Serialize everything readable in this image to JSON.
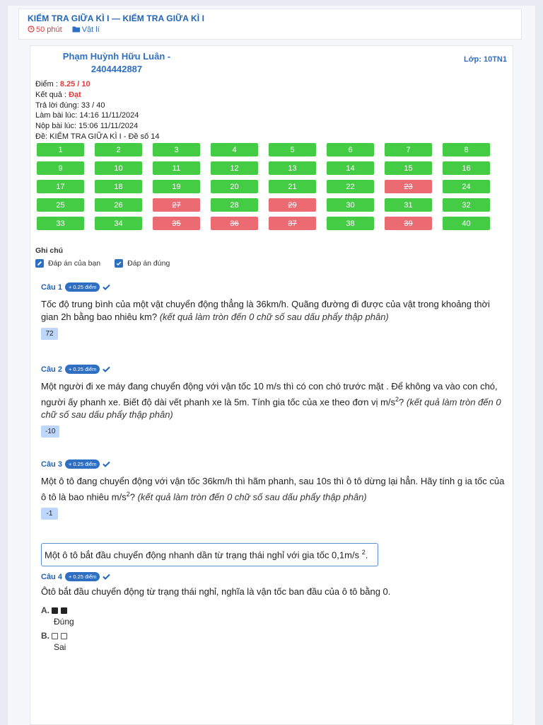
{
  "header": {
    "title": "KIỂM TRA GIỮA KÌ I — KIỂM TRA GIỮA KÌ I",
    "duration": "50 phút",
    "subject": "Vật lí"
  },
  "student": {
    "name": "Phạm Huỳnh Hữu Luân - 2404442887",
    "class_label": "Lớp: 10TN1"
  },
  "info": {
    "score_label": "Điểm :",
    "score_value": "8.25 / 10",
    "result_label": "Kết quả :",
    "result_value": "Đạt",
    "correct": "Trả lời đúng: 33 / 40",
    "start": "Làm bài lúc: 14:16 11/11/2024",
    "submit": "Nộp bài lúc: 15:06 11/11/2024",
    "exam": "Đề: KIỂM TRA GIỮA KÌ I - Đề số 14"
  },
  "question_grid": [
    {
      "n": "1",
      "ok": true
    },
    {
      "n": "2",
      "ok": true
    },
    {
      "n": "3",
      "ok": true
    },
    {
      "n": "4",
      "ok": true
    },
    {
      "n": "5",
      "ok": true
    },
    {
      "n": "6",
      "ok": true
    },
    {
      "n": "7",
      "ok": true
    },
    {
      "n": "8",
      "ok": true
    },
    {
      "n": "9",
      "ok": true
    },
    {
      "n": "10",
      "ok": true
    },
    {
      "n": "11",
      "ok": true
    },
    {
      "n": "12",
      "ok": true
    },
    {
      "n": "13",
      "ok": true
    },
    {
      "n": "14",
      "ok": true
    },
    {
      "n": "15",
      "ok": true
    },
    {
      "n": "16",
      "ok": true
    },
    {
      "n": "17",
      "ok": true
    },
    {
      "n": "18",
      "ok": true
    },
    {
      "n": "19",
      "ok": true
    },
    {
      "n": "20",
      "ok": true
    },
    {
      "n": "21",
      "ok": true
    },
    {
      "n": "22",
      "ok": true
    },
    {
      "n": "23",
      "ok": false
    },
    {
      "n": "24",
      "ok": true
    },
    {
      "n": "25",
      "ok": true
    },
    {
      "n": "26",
      "ok": true
    },
    {
      "n": "27",
      "ok": false
    },
    {
      "n": "28",
      "ok": true
    },
    {
      "n": "29",
      "ok": false
    },
    {
      "n": "30",
      "ok": true
    },
    {
      "n": "31",
      "ok": true
    },
    {
      "n": "32",
      "ok": true
    },
    {
      "n": "33",
      "ok": true
    },
    {
      "n": "34",
      "ok": true
    },
    {
      "n": "35",
      "ok": false
    },
    {
      "n": "36",
      "ok": false
    },
    {
      "n": "37",
      "ok": false
    },
    {
      "n": "38",
      "ok": true
    },
    {
      "n": "39",
      "ok": false
    },
    {
      "n": "40",
      "ok": true
    }
  ],
  "notes": {
    "title": "Ghi chú",
    "your_answer": "Đáp án của bạn",
    "correct_answer": "Đáp án đúng"
  },
  "questions": {
    "q1": {
      "label": "Câu 1",
      "points": "+ 0.25 điểm",
      "text": "Tốc độ trung bình của một vật chuyển động thẳng là 36km/h. Quãng đường đi được của vật trong khoảng thời gian 2h bằng bao nhiêu km? ",
      "hint": "(kết quả làm tròn đến 0 chữ số sau dấu phẩy thập phân)",
      "answer": "72"
    },
    "q2": {
      "label": "Câu 2",
      "points": "+ 0.25 điểm",
      "text": "Một người đi xe máy đang chuyển động với vận tốc 10 m/s thì có con chó trước mặt . Để không va vào con chó, người ấy phanh xe. Biết độ dài vết phanh xe là 5m. Tính gia tốc của xe theo đơn vị m/s",
      "sup": "2",
      "tail": "? ",
      "hint": "(kết quả làm tròn đến 0 chữ số sau dấu phẩy thập phân)",
      "answer": "-10"
    },
    "q3": {
      "label": "Câu 3",
      "points": "+ 0.25 điểm",
      "text": "Một ô tô đang chuyển động với vận tốc 36km/h thì hãm phanh, sau 10s thì ô tô dừng lại hẳn. Hãy tính g ia tốc của ô tô là bao nhiêu m/s",
      "sup": "2",
      "tail": "? ",
      "hint": "(kết quả làm tròn đến 0 chữ số sau dấu phẩy thập phân)",
      "answer": "-1"
    },
    "context": {
      "text": "Một ô tô bắt đầu chuyển động nhanh dần từ trạng thái nghỉ với gia tốc 0,1m/s ",
      "sup": "2",
      "tail": "."
    },
    "q4": {
      "label": "Câu 4",
      "points": "+ 0.25 điểm",
      "text": "Ôtô bắt đầu chuyển động từ trạng thái nghỉ, nghĩa là vận tốc ban đầu của ô tô bằng 0.",
      "options": [
        {
          "label": "A.",
          "text": "Đúng"
        },
        {
          "label": "B.",
          "text": "Sai"
        }
      ]
    }
  }
}
